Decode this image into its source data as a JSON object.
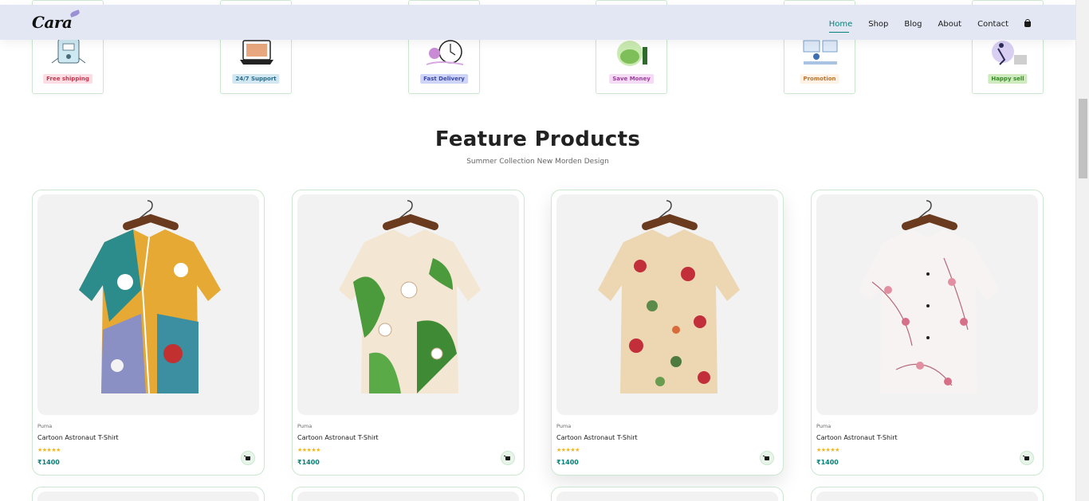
{
  "header": {
    "logo": "Cara",
    "nav": [
      {
        "label": "Home",
        "active": true
      },
      {
        "label": "Shop",
        "active": false
      },
      {
        "label": "Blog",
        "active": false
      },
      {
        "label": "About",
        "active": false
      },
      {
        "label": "Contact",
        "active": false
      }
    ],
    "cart_icon": "bag-icon"
  },
  "features": [
    {
      "label": "Free shipping",
      "bg": "#fddde4"
    },
    {
      "label": "24/7 Support",
      "bg": "#cdebbc"
    },
    {
      "label": "Fast Delivery",
      "bg": "#d1e8f2"
    },
    {
      "label": "Save Money",
      "bg": "#cdd4f8"
    },
    {
      "label": "Promotion",
      "bg": "#f6dbf6"
    },
    {
      "label": "Happy sell",
      "bg": "#fff2e5"
    }
  ],
  "section": {
    "title": "Feature Products",
    "subtitle": "Summer Collection New Morden Design"
  },
  "products": [
    {
      "brand": "Puma",
      "name": "Cartoon Astronaut T-Shirt",
      "stars": "★★★★★",
      "price": "₹1400"
    },
    {
      "brand": "Puma",
      "name": "Cartoon Astronaut T-Shirt",
      "stars": "★★★★★",
      "price": "₹1400"
    },
    {
      "brand": "Puma",
      "name": "Cartoon Astronaut T-Shirt",
      "stars": "★★★★★",
      "price": "₹1400"
    },
    {
      "brand": "Puma",
      "name": "Cartoon Astronaut T-Shirt",
      "stars": "★★★★★",
      "price": "₹1400"
    }
  ],
  "colors": {
    "accent": "#088178",
    "header_bg": "#e3e6f3",
    "card_border": "#cce7d0",
    "star": "#f3b519"
  }
}
